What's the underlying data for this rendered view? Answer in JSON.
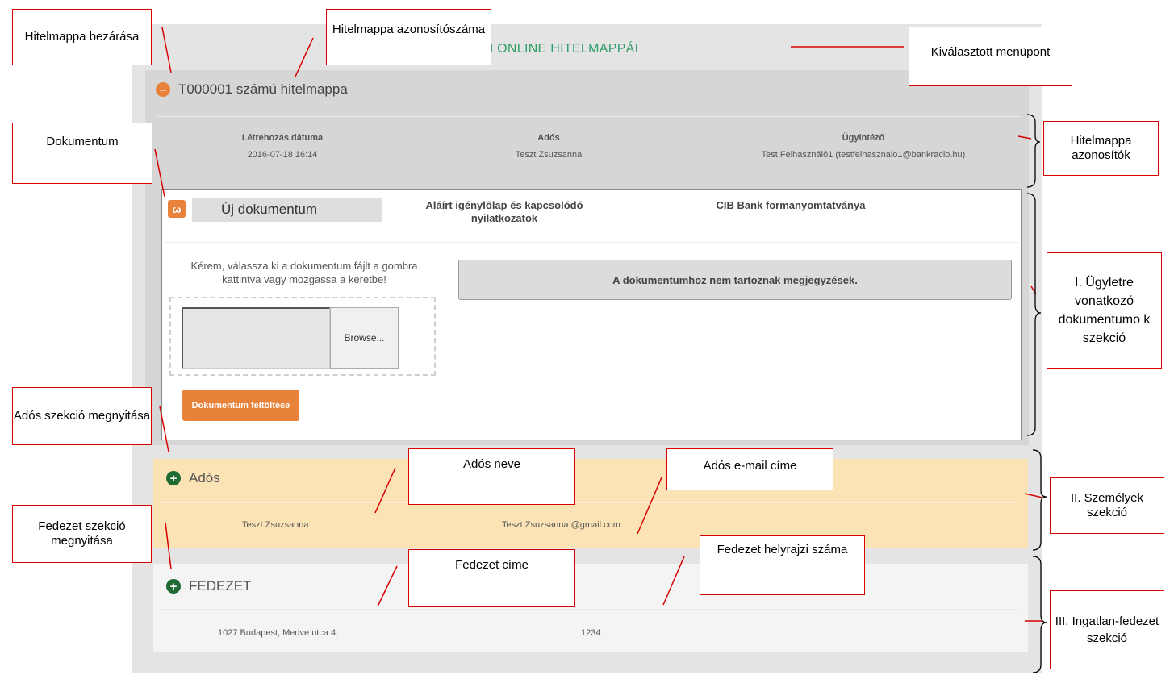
{
  "page": {
    "title": "Z ÖN ONLINE HITELMAPPÁI"
  },
  "folder": {
    "toggle_symbol": "–",
    "title": "T000001 számú hitelmappa",
    "info": {
      "created_label": "Létrehozás dátuma",
      "created_value": "2016-07-18 16:14",
      "debtor_label": "Adós",
      "debtor_value": "Teszt Zsuzsanna",
      "clerk_label": "Ügyintéző",
      "clerk_value": "Test Felhasználó1 (testfelhasznalo1@bankracio.hu)"
    }
  },
  "document": {
    "icon_glyph": "ω",
    "type": "Új dokumentum",
    "name": "Aláírt igénylőlap és kapcsolódó nyilatkozatok",
    "source": "CIB Bank formanyomtatványa",
    "instructions": "Kérem, válassza ki a dokumentum fájlt a gombra kattintva vagy mozgassa a keretbe!",
    "browse_label": "Browse...",
    "upload_label": "Dokumentum feltöltése",
    "notes_text": "A dokumentumhoz nem tartoznak megjegyzések."
  },
  "debtor_section": {
    "toggle_symbol": "+",
    "title": "Adós",
    "name": "Teszt Zsuzsanna",
    "email": "Teszt Zsuzsanna @gmail.com"
  },
  "collateral_section": {
    "toggle_symbol": "+",
    "title": "FEDEZET",
    "address": "1027 Budapest, Medve utca 4.",
    "parcel_number": "1234"
  },
  "annotations": {
    "close_folder": "Hitelmappa bezárása",
    "folder_id": "Hitelmappa azonosítószáma",
    "selected_menu": "Kiválasztott menüpont",
    "document": "Dokumentum",
    "folder_identifiers": "Hitelmappa azonosítók",
    "documents_section": "I. Ügyletre vonatkozó dokumentumo k szekció",
    "open_debtor": "Adós szekció megnyitása",
    "debtor_name": "Adós neve",
    "debtor_email": "Adós e-mail címe",
    "persons_section": "II. Személyek szekció",
    "open_collateral": "Fedezet szekció megnyitása",
    "collateral_address": "Fedezet címe",
    "parcel_number": "Fedezet helyrajzi száma",
    "real_estate_section": "III. Ingatlan-fedezet szekció"
  }
}
